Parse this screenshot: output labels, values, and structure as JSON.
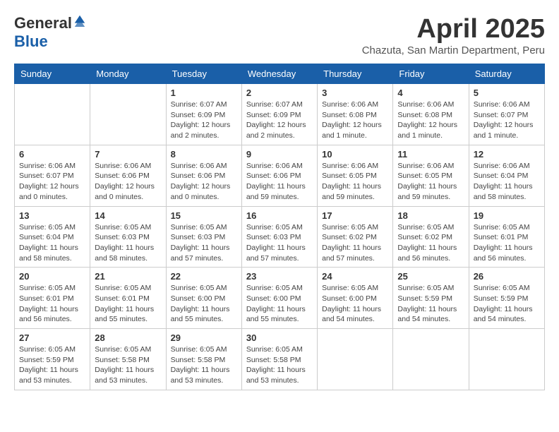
{
  "logo": {
    "general": "General",
    "blue": "Blue"
  },
  "title": "April 2025",
  "location": "Chazuta, San Martin Department, Peru",
  "weekdays": [
    "Sunday",
    "Monday",
    "Tuesday",
    "Wednesday",
    "Thursday",
    "Friday",
    "Saturday"
  ],
  "weeks": [
    [
      {
        "day": "",
        "info": ""
      },
      {
        "day": "",
        "info": ""
      },
      {
        "day": "1",
        "info": "Sunrise: 6:07 AM\nSunset: 6:09 PM\nDaylight: 12 hours\nand 2 minutes."
      },
      {
        "day": "2",
        "info": "Sunrise: 6:07 AM\nSunset: 6:09 PM\nDaylight: 12 hours\nand 2 minutes."
      },
      {
        "day": "3",
        "info": "Sunrise: 6:06 AM\nSunset: 6:08 PM\nDaylight: 12 hours\nand 1 minute."
      },
      {
        "day": "4",
        "info": "Sunrise: 6:06 AM\nSunset: 6:08 PM\nDaylight: 12 hours\nand 1 minute."
      },
      {
        "day": "5",
        "info": "Sunrise: 6:06 AM\nSunset: 6:07 PM\nDaylight: 12 hours\nand 1 minute."
      }
    ],
    [
      {
        "day": "6",
        "info": "Sunrise: 6:06 AM\nSunset: 6:07 PM\nDaylight: 12 hours\nand 0 minutes."
      },
      {
        "day": "7",
        "info": "Sunrise: 6:06 AM\nSunset: 6:06 PM\nDaylight: 12 hours\nand 0 minutes."
      },
      {
        "day": "8",
        "info": "Sunrise: 6:06 AM\nSunset: 6:06 PM\nDaylight: 12 hours\nand 0 minutes."
      },
      {
        "day": "9",
        "info": "Sunrise: 6:06 AM\nSunset: 6:06 PM\nDaylight: 11 hours\nand 59 minutes."
      },
      {
        "day": "10",
        "info": "Sunrise: 6:06 AM\nSunset: 6:05 PM\nDaylight: 11 hours\nand 59 minutes."
      },
      {
        "day": "11",
        "info": "Sunrise: 6:06 AM\nSunset: 6:05 PM\nDaylight: 11 hours\nand 59 minutes."
      },
      {
        "day": "12",
        "info": "Sunrise: 6:06 AM\nSunset: 6:04 PM\nDaylight: 11 hours\nand 58 minutes."
      }
    ],
    [
      {
        "day": "13",
        "info": "Sunrise: 6:05 AM\nSunset: 6:04 PM\nDaylight: 11 hours\nand 58 minutes."
      },
      {
        "day": "14",
        "info": "Sunrise: 6:05 AM\nSunset: 6:03 PM\nDaylight: 11 hours\nand 58 minutes."
      },
      {
        "day": "15",
        "info": "Sunrise: 6:05 AM\nSunset: 6:03 PM\nDaylight: 11 hours\nand 57 minutes."
      },
      {
        "day": "16",
        "info": "Sunrise: 6:05 AM\nSunset: 6:03 PM\nDaylight: 11 hours\nand 57 minutes."
      },
      {
        "day": "17",
        "info": "Sunrise: 6:05 AM\nSunset: 6:02 PM\nDaylight: 11 hours\nand 57 minutes."
      },
      {
        "day": "18",
        "info": "Sunrise: 6:05 AM\nSunset: 6:02 PM\nDaylight: 11 hours\nand 56 minutes."
      },
      {
        "day": "19",
        "info": "Sunrise: 6:05 AM\nSunset: 6:01 PM\nDaylight: 11 hours\nand 56 minutes."
      }
    ],
    [
      {
        "day": "20",
        "info": "Sunrise: 6:05 AM\nSunset: 6:01 PM\nDaylight: 11 hours\nand 56 minutes."
      },
      {
        "day": "21",
        "info": "Sunrise: 6:05 AM\nSunset: 6:01 PM\nDaylight: 11 hours\nand 55 minutes."
      },
      {
        "day": "22",
        "info": "Sunrise: 6:05 AM\nSunset: 6:00 PM\nDaylight: 11 hours\nand 55 minutes."
      },
      {
        "day": "23",
        "info": "Sunrise: 6:05 AM\nSunset: 6:00 PM\nDaylight: 11 hours\nand 55 minutes."
      },
      {
        "day": "24",
        "info": "Sunrise: 6:05 AM\nSunset: 6:00 PM\nDaylight: 11 hours\nand 54 minutes."
      },
      {
        "day": "25",
        "info": "Sunrise: 6:05 AM\nSunset: 5:59 PM\nDaylight: 11 hours\nand 54 minutes."
      },
      {
        "day": "26",
        "info": "Sunrise: 6:05 AM\nSunset: 5:59 PM\nDaylight: 11 hours\nand 54 minutes."
      }
    ],
    [
      {
        "day": "27",
        "info": "Sunrise: 6:05 AM\nSunset: 5:59 PM\nDaylight: 11 hours\nand 53 minutes."
      },
      {
        "day": "28",
        "info": "Sunrise: 6:05 AM\nSunset: 5:58 PM\nDaylight: 11 hours\nand 53 minutes."
      },
      {
        "day": "29",
        "info": "Sunrise: 6:05 AM\nSunset: 5:58 PM\nDaylight: 11 hours\nand 53 minutes."
      },
      {
        "day": "30",
        "info": "Sunrise: 6:05 AM\nSunset: 5:58 PM\nDaylight: 11 hours\nand 53 minutes."
      },
      {
        "day": "",
        "info": ""
      },
      {
        "day": "",
        "info": ""
      },
      {
        "day": "",
        "info": ""
      }
    ]
  ]
}
